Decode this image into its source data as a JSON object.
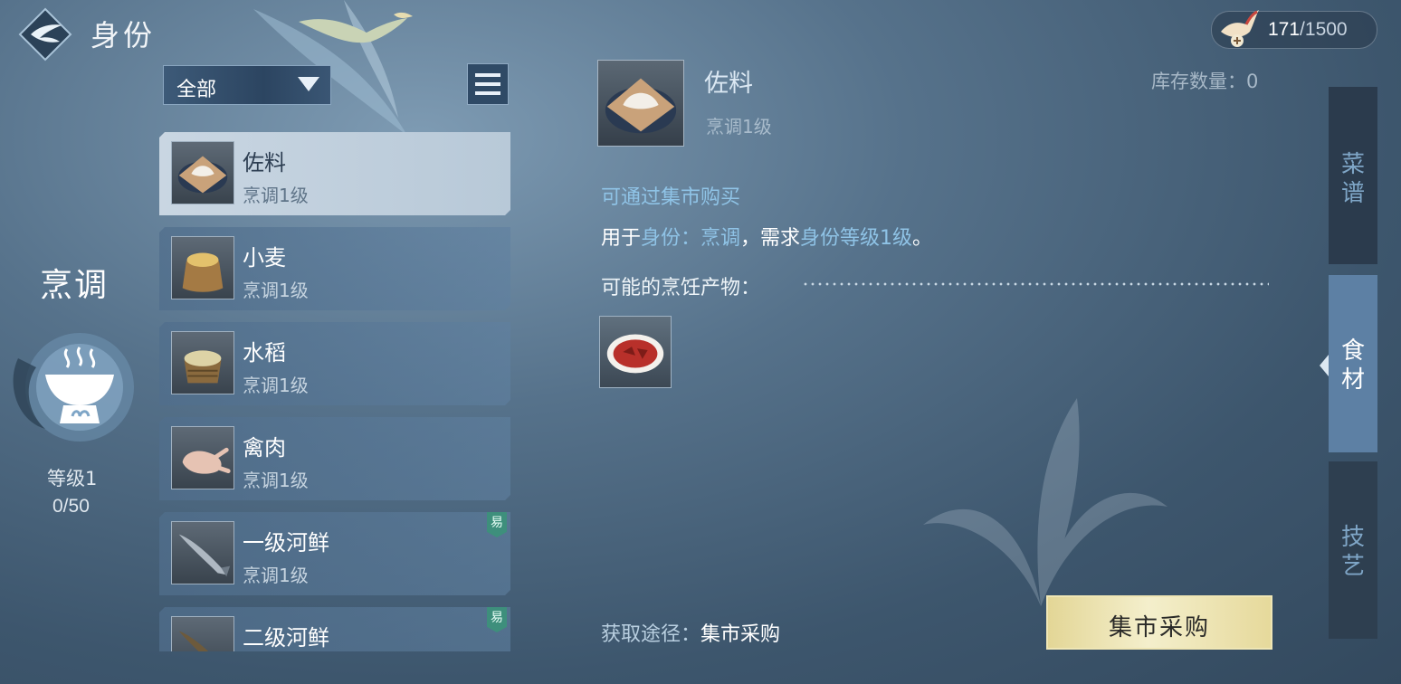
{
  "header": {
    "title": "身份"
  },
  "currency": {
    "value": "171",
    "separator": "/",
    "max": "1500"
  },
  "profession": {
    "name": "烹调",
    "level_label": "等级1",
    "exp": "0/50"
  },
  "filter": {
    "selected": "全部"
  },
  "items": [
    {
      "name": "佐料",
      "level": "烹调1级",
      "badge": "",
      "selected": true
    },
    {
      "name": "小麦",
      "level": "烹调1级",
      "badge": ""
    },
    {
      "name": "水稻",
      "level": "烹调1级",
      "badge": ""
    },
    {
      "name": "禽肉",
      "level": "烹调1级",
      "badge": ""
    },
    {
      "name": "一级河鲜",
      "level": "烹调1级",
      "badge": "易"
    },
    {
      "name": "二级河鲜",
      "level": "",
      "badge": "易"
    }
  ],
  "detail": {
    "name": "佐料",
    "level": "烹调1级",
    "stock": "库存数量：0",
    "obtain_hint": "可通过集市购买",
    "usage_prefix": "用于",
    "usage_hl1": "身份：烹调",
    "usage_mid": "，需求",
    "usage_hl2": "身份等级1级",
    "usage_end": "。",
    "products_label": "可能的烹饪产物：",
    "source_label": "获取途径：",
    "source_value": "集市采购",
    "market_button": "集市采购"
  },
  "tabs": {
    "recipe": [
      "菜",
      "谱"
    ],
    "food": [
      "食",
      "材"
    ],
    "skill": [
      "技",
      "艺"
    ]
  }
}
